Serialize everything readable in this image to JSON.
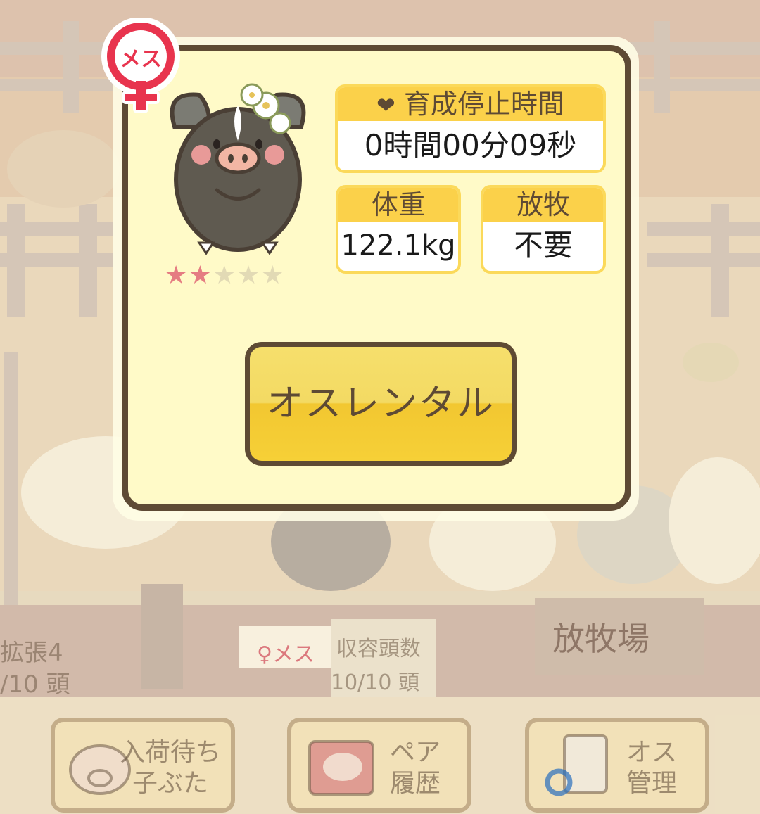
{
  "sex_badge": "メス",
  "pig": {
    "stars_filled": 2,
    "stars_total": 5
  },
  "growth_stop": {
    "label": "育成停止時間",
    "value": "0時間00分09秒",
    "icon": "heart-icon"
  },
  "weight": {
    "label": "体重",
    "value": "122.1kg"
  },
  "grazing": {
    "label": "放牧",
    "value": "不要"
  },
  "rental_button": "オスレンタル",
  "background": {
    "expansion_label": "拡張4",
    "expansion_count": "/10 頭",
    "female_tag": "メス",
    "capacity_label": "収容頭数",
    "capacity_value": "10/10 頭",
    "pasture_sign": "放牧場",
    "tabs": [
      {
        "line1": "入荷待ち",
        "line2": "子ぶた",
        "icon": "piglet-icon"
      },
      {
        "line1": "ペア",
        "line2": "履歴",
        "icon": "pair-book-icon"
      },
      {
        "line1": "オス",
        "line2": "管理",
        "icon": "male-list-icon"
      }
    ]
  },
  "colors": {
    "panel": "#fffac8",
    "border": "#5e4a34",
    "accent_yellow": "#fbd14a",
    "badge_red": "#e8344e"
  }
}
